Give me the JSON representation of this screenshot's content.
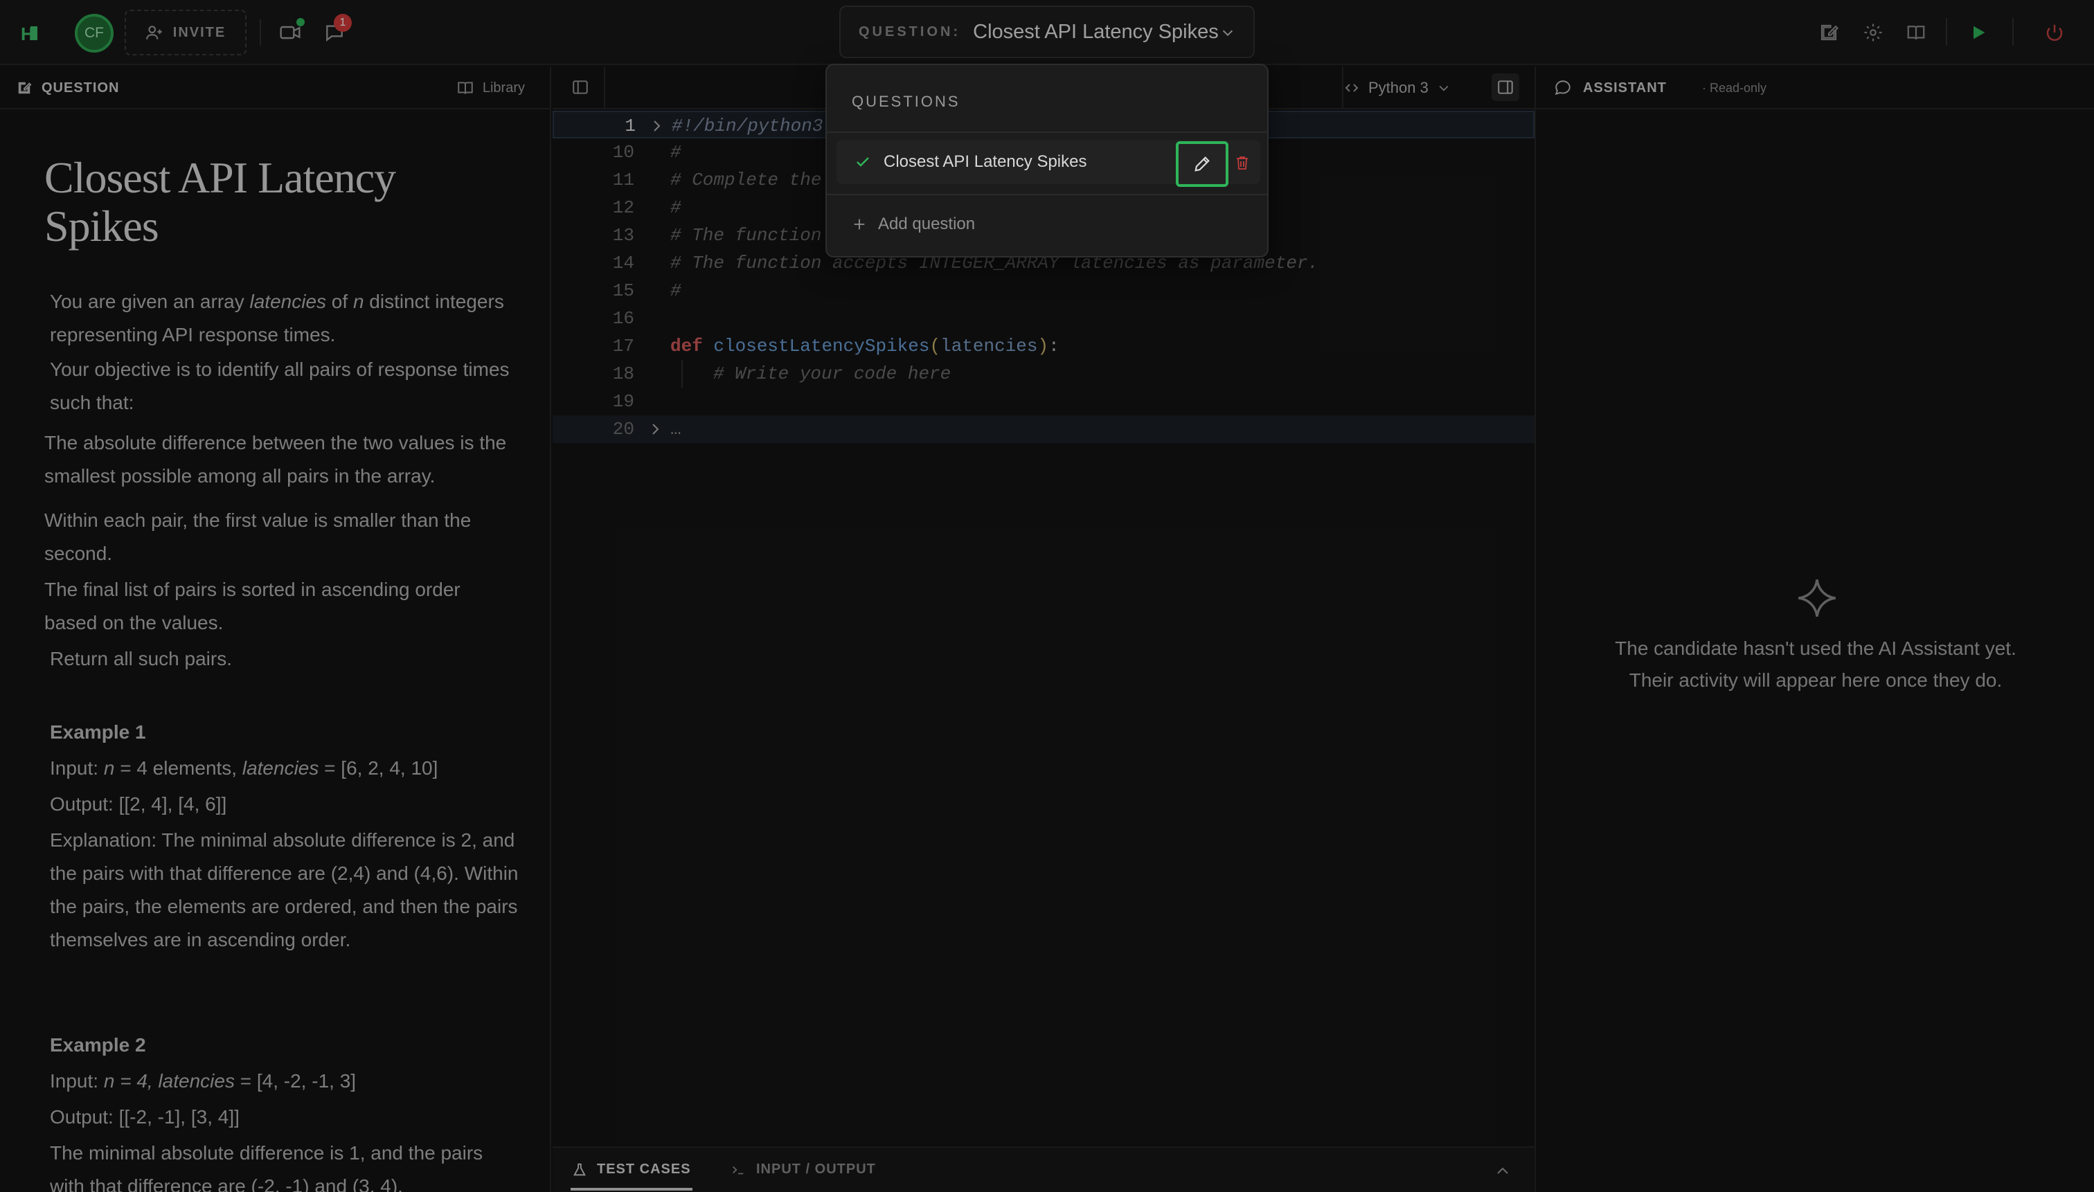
{
  "topbar": {
    "logo": "H",
    "avatar_initials": "CF",
    "invite_label": "INVITE",
    "notification_count": "1",
    "question_label": "QUESTION:",
    "question_value": "Closest API Latency Spikes"
  },
  "left_panel": {
    "header_title": "QUESTION",
    "library_label": "Library",
    "question_title": "Closest API Latency Spikes"
  },
  "editor": {
    "language": "Python 3",
    "lines": [
      {
        "num": "1",
        "text": "#!/bin/python3"
      },
      {
        "num": "10",
        "text": "#"
      },
      {
        "num": "11",
        "text": "# Complete the"
      },
      {
        "num": "12",
        "text": "#"
      },
      {
        "num": "13",
        "text": "# The function"
      },
      {
        "num": "14",
        "text": "# The function accepts INTEGER_ARRAY latencies as parameter."
      },
      {
        "num": "15",
        "text": "#"
      },
      {
        "num": "16",
        "text": ""
      },
      {
        "num": "17",
        "text": "def closestLatencySpikes(latencies):"
      },
      {
        "num": "18",
        "text": "# Write your code here"
      },
      {
        "num": "19",
        "text": ""
      },
      {
        "num": "20",
        "text": "…"
      }
    ]
  },
  "bottom_tabs": {
    "test_cases": "TEST CASES",
    "input_output": "INPUT / OUTPUT"
  },
  "assistant": {
    "title": "ASSISTANT",
    "subtitle": "· Read-only",
    "empty_line1": "The candidate hasn't used the AI Assistant yet.",
    "empty_line2": "Their activity will appear here once they do."
  },
  "dropdown": {
    "header": "QUESTIONS",
    "items": [
      {
        "label": "Closest API Latency Spikes"
      }
    ],
    "add_label": "Add question"
  },
  "colors": {
    "accent_green": "#2fb55a",
    "danger_red": "#d33a3a"
  }
}
